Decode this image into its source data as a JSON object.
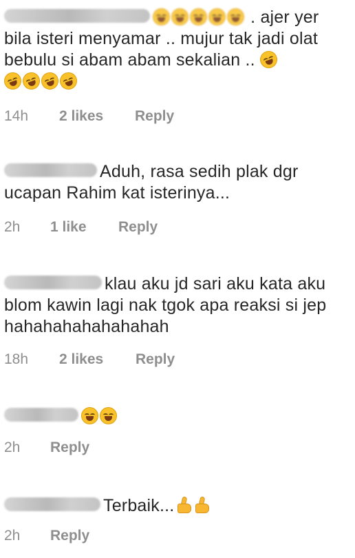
{
  "comments": [
    {
      "text": ". ajer yer bila isteri menyamar .. mujur tak jadi olat bebulu si abam abam sekalian ..",
      "time": "14h",
      "likes": "2 likes",
      "reply": "Reply"
    },
    {
      "text": "Aduh, rasa sedih plak dgr ucapan Rahim kat isterinya...",
      "time": "2h",
      "likes": "1 like",
      "reply": "Reply"
    },
    {
      "text": "klau aku jd sari aku kata aku blom kawin lagi nak tgok apa reaksi si jep hahahahahahahahah",
      "time": "18h",
      "likes": "2 likes",
      "reply": "Reply"
    },
    {
      "text": "",
      "time": "2h",
      "reply": "Reply"
    },
    {
      "text": "Terbaik...",
      "time": "2h",
      "reply": "Reply"
    }
  ]
}
